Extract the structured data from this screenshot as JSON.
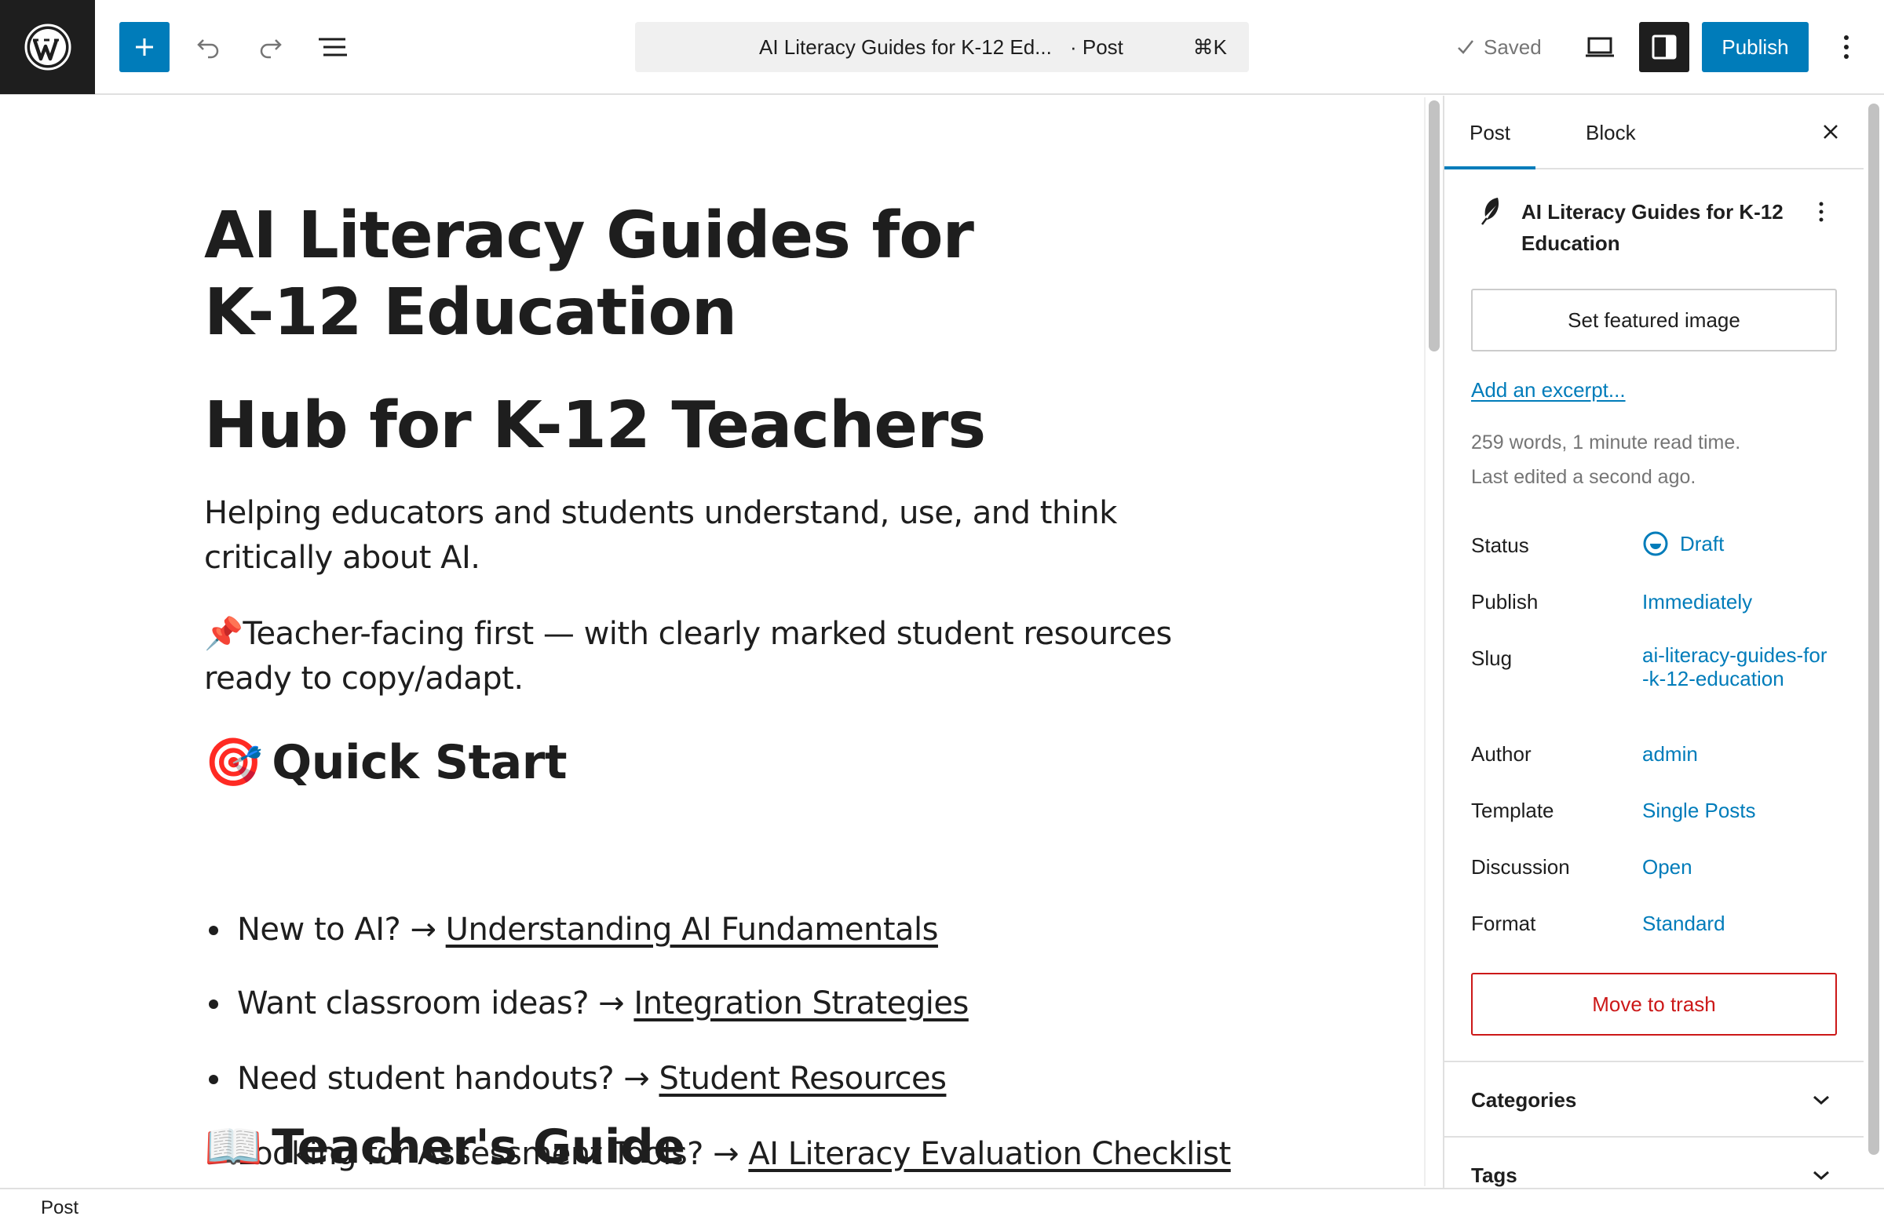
{
  "toolbar": {
    "document_title": "AI Literacy Guides for K-12 Ed...",
    "document_type": "· Post",
    "shortcut": "⌘K",
    "saved_label": "Saved",
    "publish_label": "Publish",
    "accent_color": "#007cba"
  },
  "post": {
    "title": "AI Literacy Guides for K-12 Education",
    "heading": "Hub for K-12 Teachers",
    "intro": "Helping educators and students understand, use, and think critically about AI.",
    "note_emoji": "📌",
    "note": "Teacher-facing first — with clearly marked student resources ready to copy/adapt.",
    "quick_start": {
      "emoji": "🎯",
      "heading": "Quick Start",
      "items": [
        {
          "prefix": "New to AI? → ",
          "link": "Understanding AI Fundamentals"
        },
        {
          "prefix": "Want classroom ideas? → ",
          "link": "Integration Strategies"
        },
        {
          "prefix": "Need student handouts? → ",
          "link": "Student Resources"
        },
        {
          "prefix": "Looking for Assessment Tools? → ",
          "link": "AI Literacy Evaluation Checklist"
        }
      ]
    },
    "guide": {
      "emoji": "📖",
      "heading": "Teacher's Guide"
    }
  },
  "sidebar": {
    "tabs": [
      "Post",
      "Block"
    ],
    "active_tab": "Post",
    "post_card_title": "AI Literacy Guides for K-12 Education",
    "featured_image_label": "Set featured image",
    "excerpt_link": "Add an excerpt...",
    "word_count": "259 words, 1 minute read time.",
    "last_edited": "Last edited a second ago.",
    "rows": [
      {
        "label": "Status",
        "value": "Draft"
      },
      {
        "label": "Publish",
        "value": "Immediately"
      },
      {
        "label": "Slug",
        "value": "ai-literacy-guides-for-k-12-education"
      },
      {
        "label": "Author",
        "value": "admin"
      },
      {
        "label": "Template",
        "value": "Single Posts"
      },
      {
        "label": "Discussion",
        "value": "Open"
      },
      {
        "label": "Format",
        "value": "Standard"
      }
    ],
    "trash_label": "Move to trash",
    "panels": [
      "Categories",
      "Tags"
    ]
  },
  "footer": {
    "breadcrumb": "Post"
  }
}
